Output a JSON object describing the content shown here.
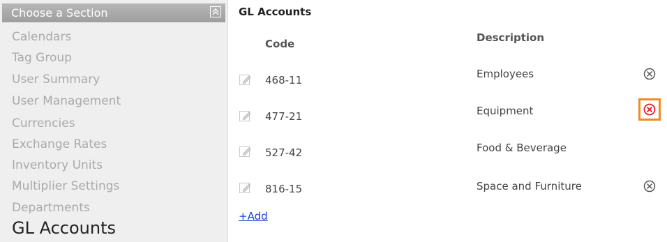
{
  "sidebar": {
    "header": "Choose a Section",
    "collapse_icon": "chevron-up-icon",
    "items": [
      {
        "label": "Calendars"
      },
      {
        "label": "Tag Group"
      },
      {
        "label": "User Summary"
      },
      {
        "label": "User Management"
      },
      {
        "label": "Currencies"
      },
      {
        "label": "Exchange Rates"
      },
      {
        "label": "Inventory Units"
      },
      {
        "label": "Multiplier Settings"
      },
      {
        "label": "Departments"
      },
      {
        "label": "GL Accounts"
      }
    ],
    "active_item": "GL Accounts"
  },
  "panel": {
    "title": "GL Accounts",
    "columns": {
      "code": "Code",
      "description": "Description"
    },
    "rows": [
      {
        "code": "468-11",
        "description": "Employees",
        "delete": "visible"
      },
      {
        "code": "477-21",
        "description": "Equipment",
        "delete": "highlighted"
      },
      {
        "code": "527-42",
        "description": "Food & Beverage",
        "delete": "none"
      },
      {
        "code": "816-15",
        "description": "Space and Furniture",
        "delete": "visible"
      }
    ],
    "add_label": "+Add"
  },
  "colors": {
    "highlight_border": "#f08a24",
    "delete_active": "#e0202a",
    "link": "#1a3fd6"
  }
}
